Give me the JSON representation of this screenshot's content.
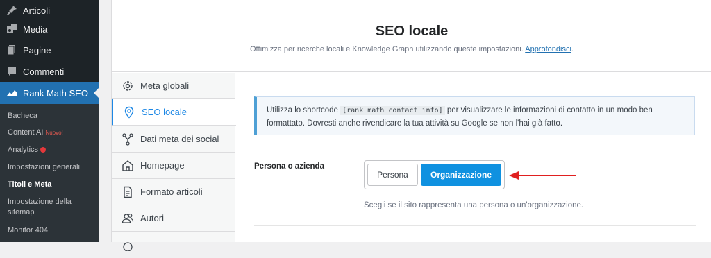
{
  "wp_menu": {
    "items": [
      {
        "label": "Articoli",
        "icon": "pin-icon"
      },
      {
        "label": "Media",
        "icon": "media-icon"
      },
      {
        "label": "Pagine",
        "icon": "page-icon"
      },
      {
        "label": "Commenti",
        "icon": "comment-icon"
      },
      {
        "label": "Rank Math SEO",
        "icon": "rank-math-icon"
      }
    ],
    "submenu": [
      {
        "label": "Bacheca"
      },
      {
        "label": "Content AI",
        "badge": "Nuovo!"
      },
      {
        "label": "Analytics"
      },
      {
        "label": "Impostazioni generali"
      },
      {
        "label": "Titoli e Meta"
      },
      {
        "label": "Impostazione della sitemap"
      },
      {
        "label": "Monitor 404"
      }
    ]
  },
  "header": {
    "title": "SEO locale",
    "description": "Ottimizza per ricerche locali e Knowledge Graph utilizzando queste impostazioni.",
    "link": "Approfondisci"
  },
  "tabs": [
    {
      "label": "Meta globali",
      "icon": "gear-icon"
    },
    {
      "label": "SEO locale",
      "icon": "location-pin-icon"
    },
    {
      "label": "Dati meta dei social",
      "icon": "social-nodes-icon"
    },
    {
      "label": "Homepage",
      "icon": "home-icon"
    },
    {
      "label": "Formato articoli",
      "icon": "document-icon"
    },
    {
      "label": "Autori",
      "icon": "users-icon"
    }
  ],
  "info": {
    "text_before": "Utilizza lo shortcode",
    "shortcode": "[rank_math_contact_info]",
    "text_after": "per visualizzare le informazioni di contatto in un modo ben formattato. Dovresti anche rivendicare la tua attività su Google se non l'hai già fatto."
  },
  "field": {
    "label": "Persona o azienda",
    "option_person": "Persona",
    "option_org": "Organizzazione",
    "selected": "Organizzazione",
    "description": "Scegli se il sito rappresenta una persona o un'organizzazione."
  },
  "colors": {
    "accent": "#0f91e0",
    "wp_active": "#2271b1",
    "arrow": "#e02020"
  }
}
